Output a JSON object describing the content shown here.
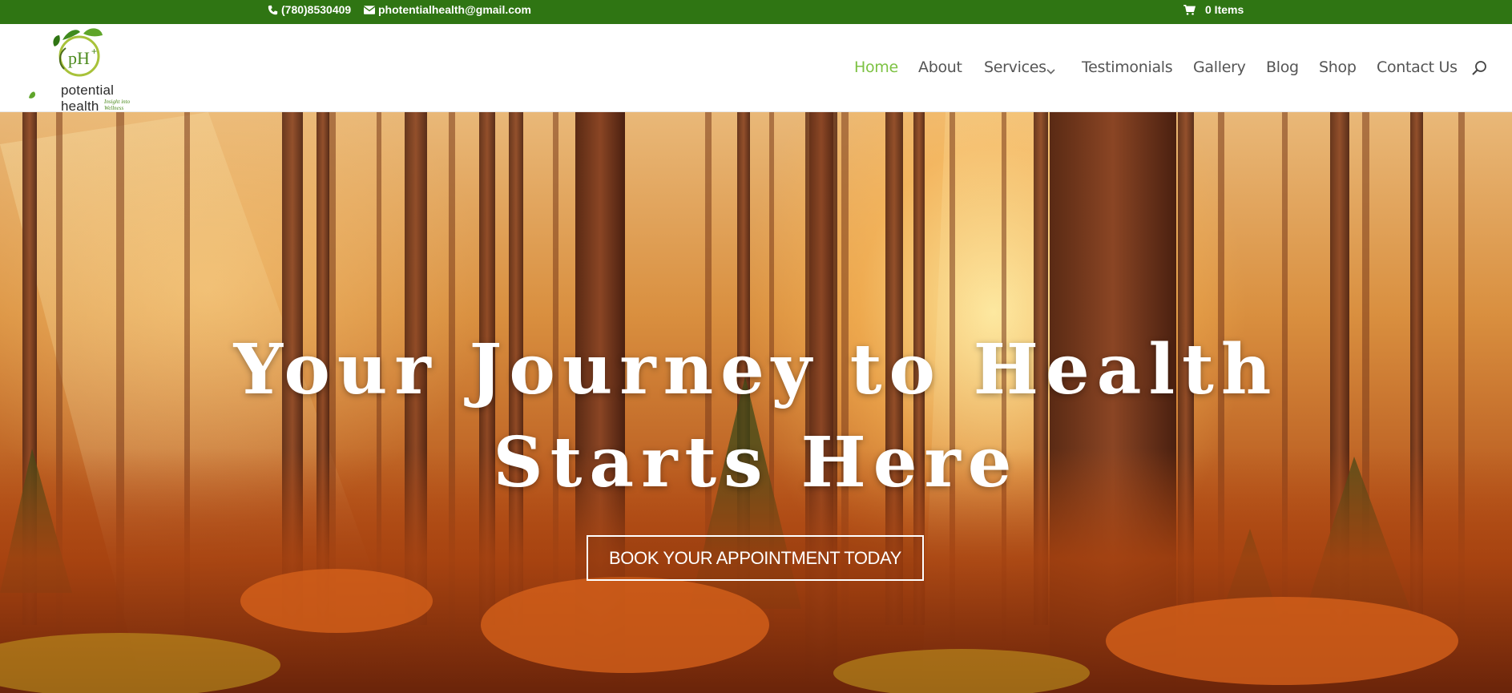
{
  "topbar": {
    "phone": "(780)8530409",
    "email": "photentialhealth@gmail.com",
    "cart": "0 Items",
    "background_color": "#2f7513"
  },
  "logo": {
    "name": "potential health",
    "tagline": "Insight into Wellness",
    "badge": "pH+",
    "icon": "leaf-logo-icon"
  },
  "nav": {
    "items": [
      {
        "label": "Home",
        "active": true
      },
      {
        "label": "About"
      },
      {
        "label": "Services"
      },
      {
        "label": "Testimonials"
      },
      {
        "label": "Gallery"
      },
      {
        "label": "Blog"
      },
      {
        "label": "Shop"
      },
      {
        "label": "Contact Us"
      }
    ],
    "active_color": "#7dc243",
    "search_icon": "search-icon",
    "services_dropdown_icon": "chevron-down-icon"
  },
  "hero": {
    "title_line1": "Your Journey to Health",
    "title_line2": "Starts Here",
    "button_label": "BOOK YOUR APPOINTMENT TODAY"
  }
}
